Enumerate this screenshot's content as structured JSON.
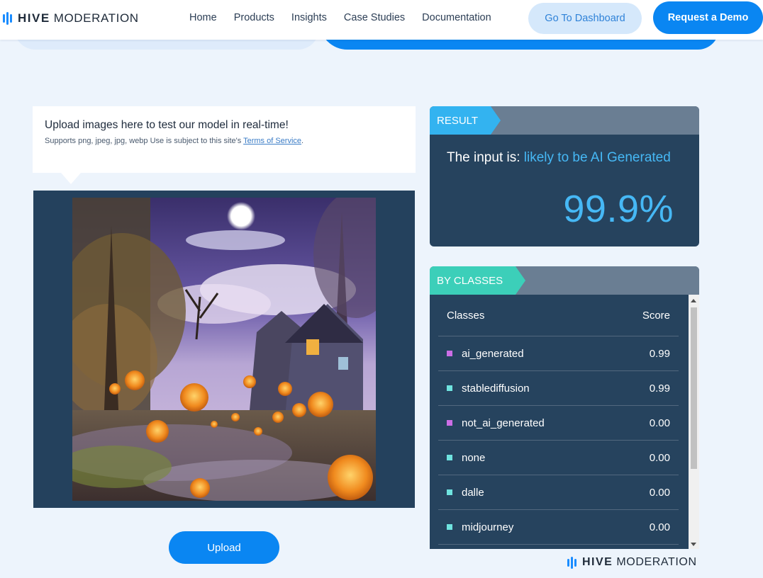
{
  "brand": {
    "word_bold": "HIVE",
    "word_light": "MODERATION",
    "accent": "#1a8cff"
  },
  "nav": {
    "items": [
      "Home",
      "Products",
      "Insights",
      "Case Studies",
      "Documentation"
    ],
    "dashboard_label": "Go To Dashboard",
    "demo_label": "Request a Demo"
  },
  "upload_note": {
    "title": "Upload images here to test our model in real-time!",
    "sub": "Supports png, jpeg, jpg, webp Use is subject to this site's ",
    "terms_link": "Terms of Service",
    "terms_suffix": "."
  },
  "image": {
    "description_icon": "halloween-scene-image"
  },
  "upload_button": "Upload",
  "result": {
    "tag": "RESULT",
    "prefix": "The input is: ",
    "verdict": "likely to be AI Generated",
    "score": "99.9%"
  },
  "by_classes": {
    "tag": "BY CLASSES",
    "col_class": "Classes",
    "col_score": "Score",
    "rows": [
      {
        "name": "ai_generated",
        "score": "0.99",
        "color": "#cc6ee6"
      },
      {
        "name": "stablediffusion",
        "score": "0.99",
        "color": "#6fe3df"
      },
      {
        "name": "not_ai_generated",
        "score": "0.00",
        "color": "#cc6ee6"
      },
      {
        "name": "none",
        "score": "0.00",
        "color": "#6fe3df"
      },
      {
        "name": "dalle",
        "score": "0.00",
        "color": "#6fe3df"
      },
      {
        "name": "midjourney",
        "score": "0.00",
        "color": "#6fe3df"
      }
    ]
  }
}
